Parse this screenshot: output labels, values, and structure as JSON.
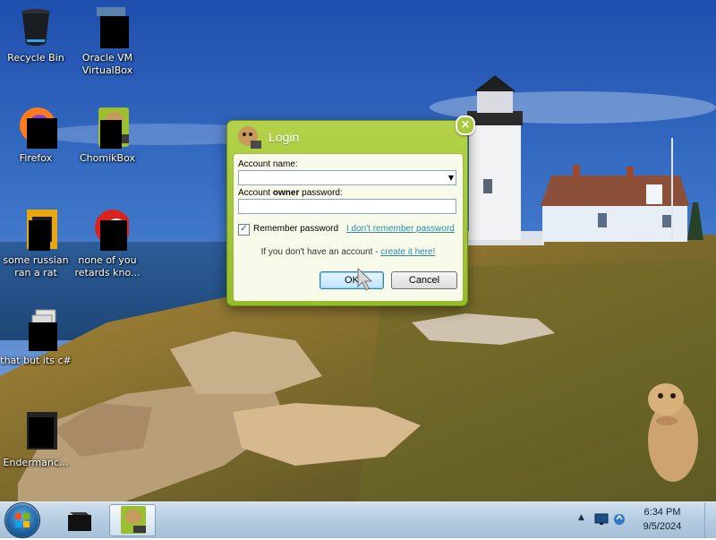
{
  "desktop": {
    "icons": [
      {
        "label": "Recycle Bin"
      },
      {
        "label": "Oracle VM VirtualBox"
      },
      {
        "label": "Firefox"
      },
      {
        "label": "ChomikBox"
      },
      {
        "label": "some russian ran a rat"
      },
      {
        "label": "none of you retards kno..."
      },
      {
        "label": "that but its c#"
      },
      {
        "label": "Endermanc..."
      }
    ]
  },
  "login_dialog": {
    "title": "Login",
    "close_glyph": "×",
    "account_name_label": "Account name:",
    "account_name_value": "",
    "password_label_prefix": "Account ",
    "password_label_bold": "owner",
    "password_label_suffix": " password:",
    "password_value": "",
    "remember_label": "Remember password",
    "remember_checked": true,
    "forgot_link": "I don't remember password",
    "no_account_text": "If you don't have an account - ",
    "create_link": "create it here!",
    "ok_label": "OK",
    "cancel_label": "Cancel"
  },
  "taskbar": {
    "time": "6:34 PM",
    "date": "9/5/2024",
    "tray_icons": [
      "chevron-up-icon",
      "monitor-icon",
      "network-icon"
    ],
    "pinned": [
      "start-orb",
      "virtualbox-icon",
      "chomikbox-icon"
    ]
  },
  "colors": {
    "dialog_green": "#a5c930",
    "taskbar": "#bcd2e6",
    "link": "#2b8aa8"
  }
}
